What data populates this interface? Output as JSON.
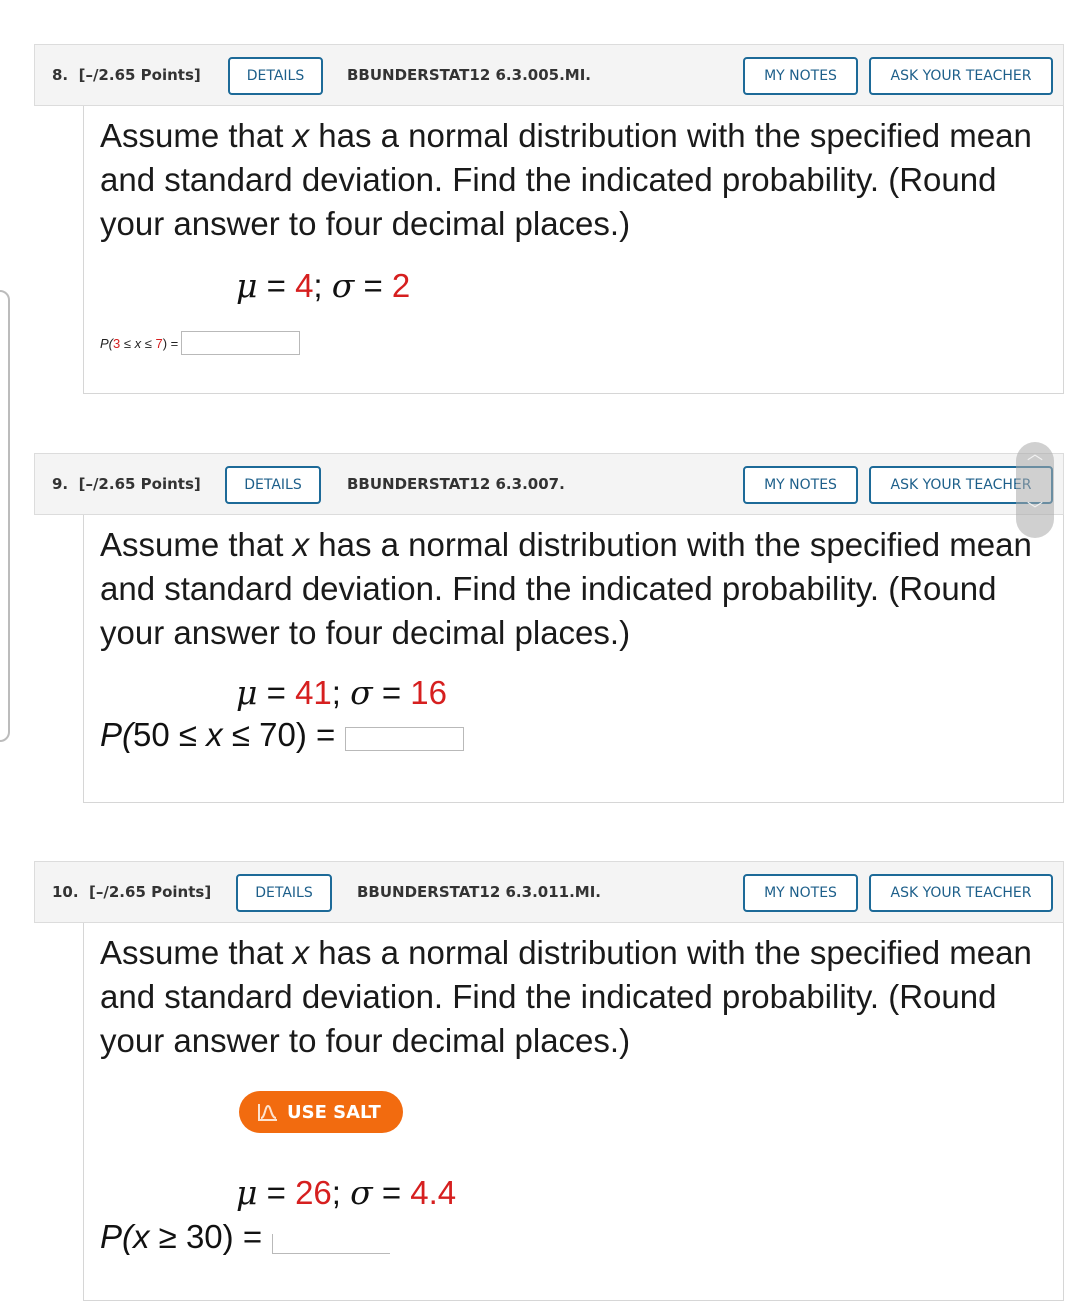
{
  "questions": [
    {
      "number": "8.",
      "points": "[–/2.65 Points]",
      "details_label": "DETAILS",
      "code": "BBUNDERSTAT12 6.3.005.MI.",
      "my_notes_label": "MY NOTES",
      "ask_teacher_label": "ASK YOUR TEACHER",
      "prompt_pre": "Assume that ",
      "prompt_var": "x",
      "prompt_post": " has a normal distribution with the specified mean and standard deviation. Find the indicated probability. (Round your answer to four decimal places.)",
      "mu_symbol": "μ",
      "mu": "4",
      "sigma_symbol": "σ",
      "sigma": "2",
      "answer_label": {
        "p": "P(",
        "lo": "3",
        "op1": " ≤ ",
        "var": "x",
        "op2": " ≤ ",
        "hi": "7",
        "close": ") ="
      },
      "answer_value": ""
    },
    {
      "number": "9.",
      "points": "[–/2.65 Points]",
      "details_label": "DETAILS",
      "code": "BBUNDERSTAT12 6.3.007.",
      "my_notes_label": "MY NOTES",
      "ask_teacher_label": "ASK YOUR TEACHER",
      "prompt_pre": "Assume that ",
      "prompt_var": "x",
      "prompt_post": " has a normal distribution with the specified mean and standard deviation. Find the indicated probability. (Round your answer to four decimal places.)",
      "mu_symbol": "μ",
      "mu": "41",
      "sigma_symbol": "σ",
      "sigma": "16",
      "answer_label": {
        "p": "P(",
        "lo": "50",
        "op1": " ≤ ",
        "var": "x",
        "op2": " ≤ ",
        "hi": "70",
        "close": ") ="
      },
      "answer_value": ""
    },
    {
      "number": "10.",
      "points": "[–/2.65 Points]",
      "details_label": "DETAILS",
      "code": "BBUNDERSTAT12 6.3.011.MI.",
      "my_notes_label": "MY NOTES",
      "ask_teacher_label": "ASK YOUR TEACHER",
      "prompt_pre": "Assume that ",
      "prompt_var": "x",
      "prompt_post": " has a normal distribution with the specified mean and standard deviation. Find the indicated probability. (Round your answer to four decimal places.)",
      "salt_label": "USE SALT",
      "mu_symbol": "μ",
      "mu": "26",
      "sigma_symbol": "σ",
      "sigma": "4.4",
      "answer_label": {
        "p": "P(",
        "var": "x",
        "op": " ≥ ",
        "val": "30",
        "close": ") ="
      },
      "answer_value": ""
    }
  ],
  "colors": {
    "accent_blue": "#1d6a98",
    "param_red": "#d61f1f",
    "salt_orange": "#f26b0f"
  }
}
